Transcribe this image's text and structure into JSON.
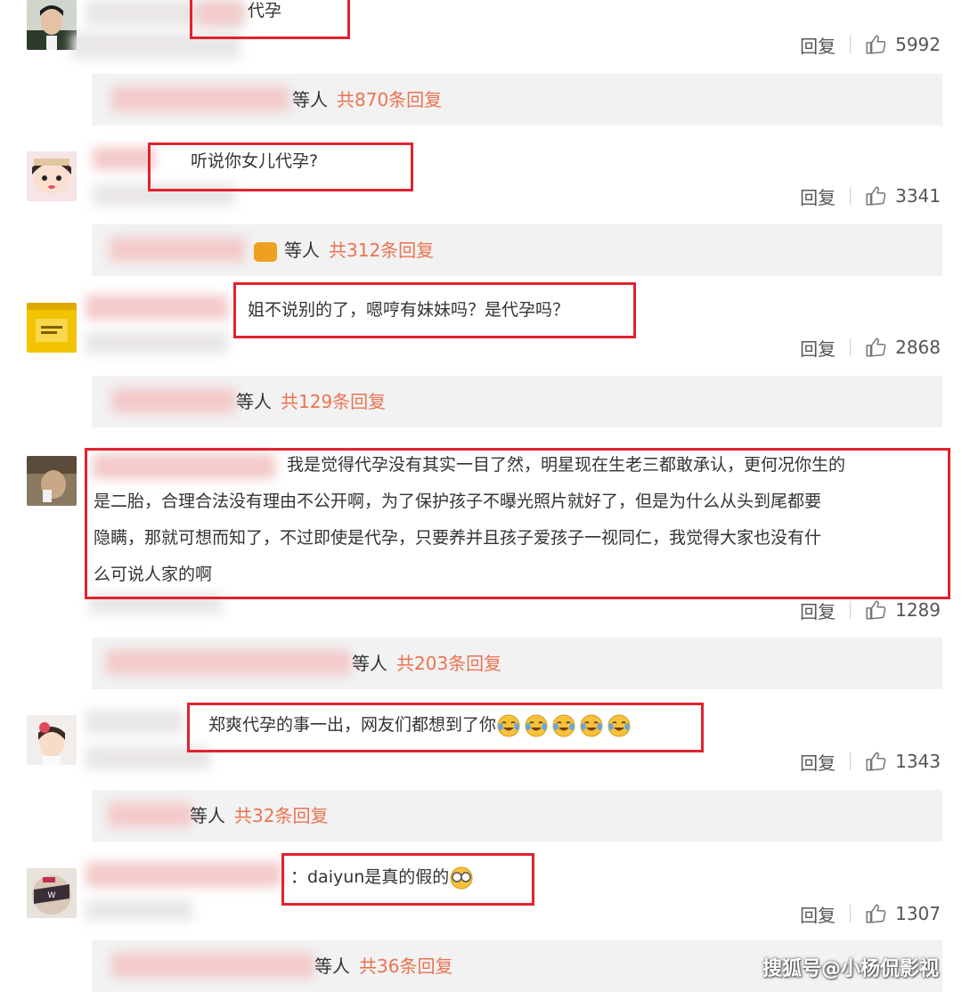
{
  "comments": [
    {
      "text": "代孕",
      "reply_label": "回复",
      "likes": "5992",
      "replies_suffix": "等人",
      "replies_count": "共870条回复"
    },
    {
      "text": "听说你女儿代孕?",
      "reply_label": "回复",
      "likes": "3341",
      "replies_suffix": "等人",
      "replies_count": "共312条回复"
    },
    {
      "text": "姐不说别的了，嗯哼有妹妹吗？是代孕吗？",
      "reply_label": "回复",
      "likes": "2868",
      "replies_suffix": "等人",
      "replies_count": "共129条回复"
    },
    {
      "text_lines": [
        "我是觉得代孕没有其实一目了然，明星现在生老三都敢承认，更何况你生的",
        "是二胎，合理合法没有理由不公开啊，为了保护孩子不曝光照片就好了，但是为什么从头到尾都要",
        "隐瞒，那就可想而知了，不过即使是代孕，只要养并且孩子爱孩子一视同仁，我觉得大家也没有什",
        "么可说人家的啊"
      ],
      "reply_label": "回复",
      "likes": "1289",
      "replies_suffix": "等人",
      "replies_count": "共203条回复"
    },
    {
      "text": "郑爽代孕的事一出，网友们都想到了你",
      "reply_label": "回复",
      "likes": "1343",
      "replies_suffix": "等人",
      "replies_count": "共32条回复"
    },
    {
      "text": "：daiyun是真的假的",
      "reply_label": "回复",
      "likes": "1307",
      "replies_suffix": "等人",
      "replies_count": "共36条回复"
    }
  ],
  "watermark": "搜狐号@小杨侃影视",
  "colors": {
    "highlight_box": "#e0232f",
    "reply_count": "#eb7350",
    "reply_bar_bg": "#f2f2f2"
  },
  "icons": {
    "like": "thumbs-up-icon",
    "emoji": "crying-laughing-emoji-icon",
    "eyes": "sunglasses-emoji-icon"
  }
}
